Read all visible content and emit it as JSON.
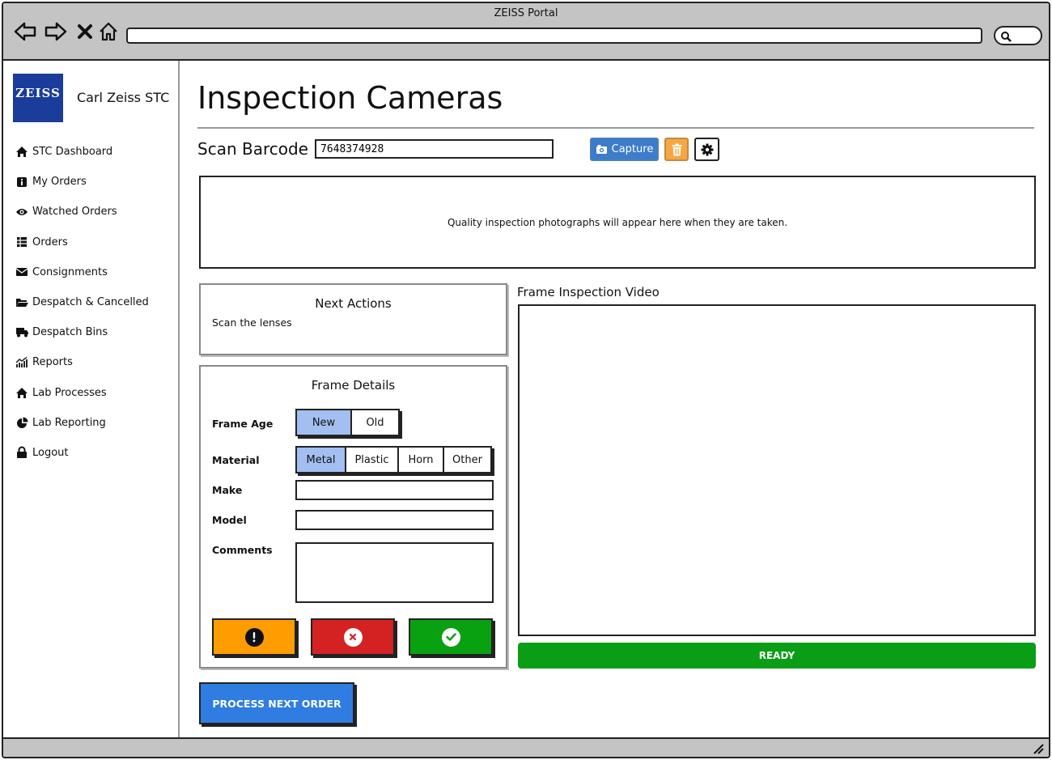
{
  "window": {
    "title": "ZEISS Portal"
  },
  "browser": {
    "url": ""
  },
  "sidebar": {
    "logo_text": "ZEISS",
    "brand_name": "Carl Zeiss STC",
    "items": [
      {
        "label": "STC Dashboard",
        "icon": "home-icon"
      },
      {
        "label": "My Orders",
        "icon": "info-icon"
      },
      {
        "label": "Watched Orders",
        "icon": "eye-icon"
      },
      {
        "label": "Orders",
        "icon": "list-icon"
      },
      {
        "label": "Consignments",
        "icon": "envelope-icon"
      },
      {
        "label": "Despatch & Cancelled",
        "icon": "folder-icon"
      },
      {
        "label": "Despatch Bins",
        "icon": "truck-icon"
      },
      {
        "label": "Reports",
        "icon": "chart-icon"
      },
      {
        "label": "Lab Processes",
        "icon": "home-icon"
      },
      {
        "label": "Lab Reporting",
        "icon": "pie-chart-icon"
      },
      {
        "label": "Logout",
        "icon": "lock-icon"
      }
    ]
  },
  "main": {
    "title": "Inspection Cameras",
    "scan_label": "Scan Barcode",
    "barcode_value": "7648374928",
    "capture_label": "Capture",
    "photo_placeholder": "Quality inspection photographs will appear here when they are taken.",
    "next_actions": {
      "title": "Next Actions",
      "text": "Scan the lenses"
    },
    "frame_details": {
      "title": "Frame Details",
      "frame_age_label": "Frame Age",
      "frame_age_options": [
        "New",
        "Old"
      ],
      "frame_age_selected": "New",
      "material_label": "Material",
      "material_options": [
        "Metal",
        "Plastic",
        "Horn",
        "Other"
      ],
      "material_selected": "Metal",
      "make_label": "Make",
      "make_value": "",
      "model_label": "Model",
      "model_value": "",
      "comments_label": "Comments",
      "comments_value": ""
    },
    "video_label": "Frame Inspection Video",
    "ready_label": "READY",
    "process_button": "PROCESS NEXT ORDER"
  },
  "colors": {
    "logo_blue": "#1a3c9a",
    "capture_blue": "#3c7ccb",
    "delete_orange": "#f7a741",
    "segment_active": "#a3bff2",
    "warn_orange": "#ff9c00",
    "reject_red": "#d42121",
    "accept_green": "#09a012",
    "ready_green": "#0a9e16",
    "process_blue": "#2f7de1"
  }
}
